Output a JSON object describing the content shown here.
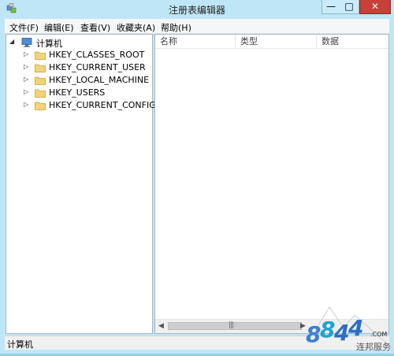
{
  "window": {
    "title": "注册表编辑器"
  },
  "menu": [
    "文件(F)",
    "编辑(E)",
    "查看(V)",
    "收藏夹(A)",
    "帮助(H)"
  ],
  "tree": {
    "root": "计算机",
    "children": [
      "HKEY_CLASSES_ROOT",
      "HKEY_CURRENT_USER",
      "HKEY_LOCAL_MACHINE",
      "HKEY_USERS",
      "HKEY_CURRENT_CONFIG"
    ]
  },
  "list": {
    "columns": [
      "名称",
      "类型",
      "数据"
    ]
  },
  "status": {
    "text": "计算机"
  },
  "watermark": {
    "logo": "8844",
    "domain": ".COM",
    "subtitle": "连邦服务"
  },
  "colors": {
    "accent": "#bfe6f6",
    "close": "#c7403a"
  }
}
